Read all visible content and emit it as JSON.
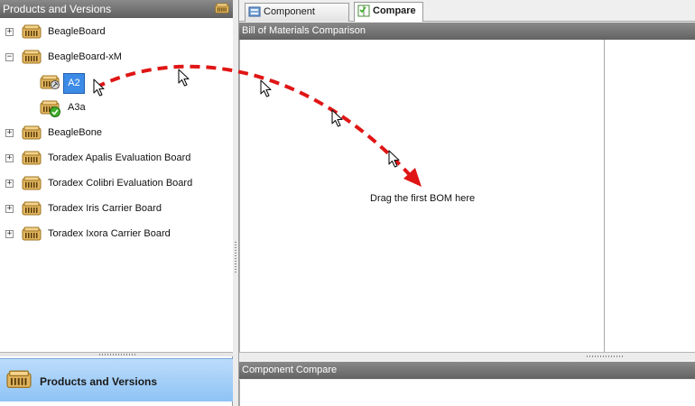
{
  "left_panel": {
    "title": "Products and Versions",
    "nav_button_label": "Products and Versions"
  },
  "tree": {
    "items": [
      {
        "label": "BeagleBoard",
        "expander": "+"
      },
      {
        "label": "BeagleBoard-xM",
        "expander": "−"
      },
      {
        "label": "A2",
        "selected": true
      },
      {
        "label": "A3a",
        "status": "approved"
      },
      {
        "label": "BeagleBone",
        "expander": "+"
      },
      {
        "label": "Toradex Apalis Evaluation Board",
        "expander": "+"
      },
      {
        "label": "Toradex Colibri Evaluation Board",
        "expander": "+"
      },
      {
        "label": "Toradex Iris Carrier Board",
        "expander": "+"
      },
      {
        "label": "Toradex Ixora Carrier Board",
        "expander": "+"
      }
    ]
  },
  "tabs": [
    {
      "label": "Component Library",
      "icon": "library-icon",
      "active": false
    },
    {
      "label": "Compare",
      "icon": "compare-icon",
      "active": true
    }
  ],
  "bom_comparison": {
    "title": "Bill of Materials Comparison",
    "drop_hint": "Drag the first BOM here"
  },
  "component_compare": {
    "title": "Component Compare"
  },
  "colors": {
    "selection": "#3c8be6",
    "arrow": "#e01515",
    "header": "#6b6b6b",
    "nav_button": "#a6d0f8"
  }
}
